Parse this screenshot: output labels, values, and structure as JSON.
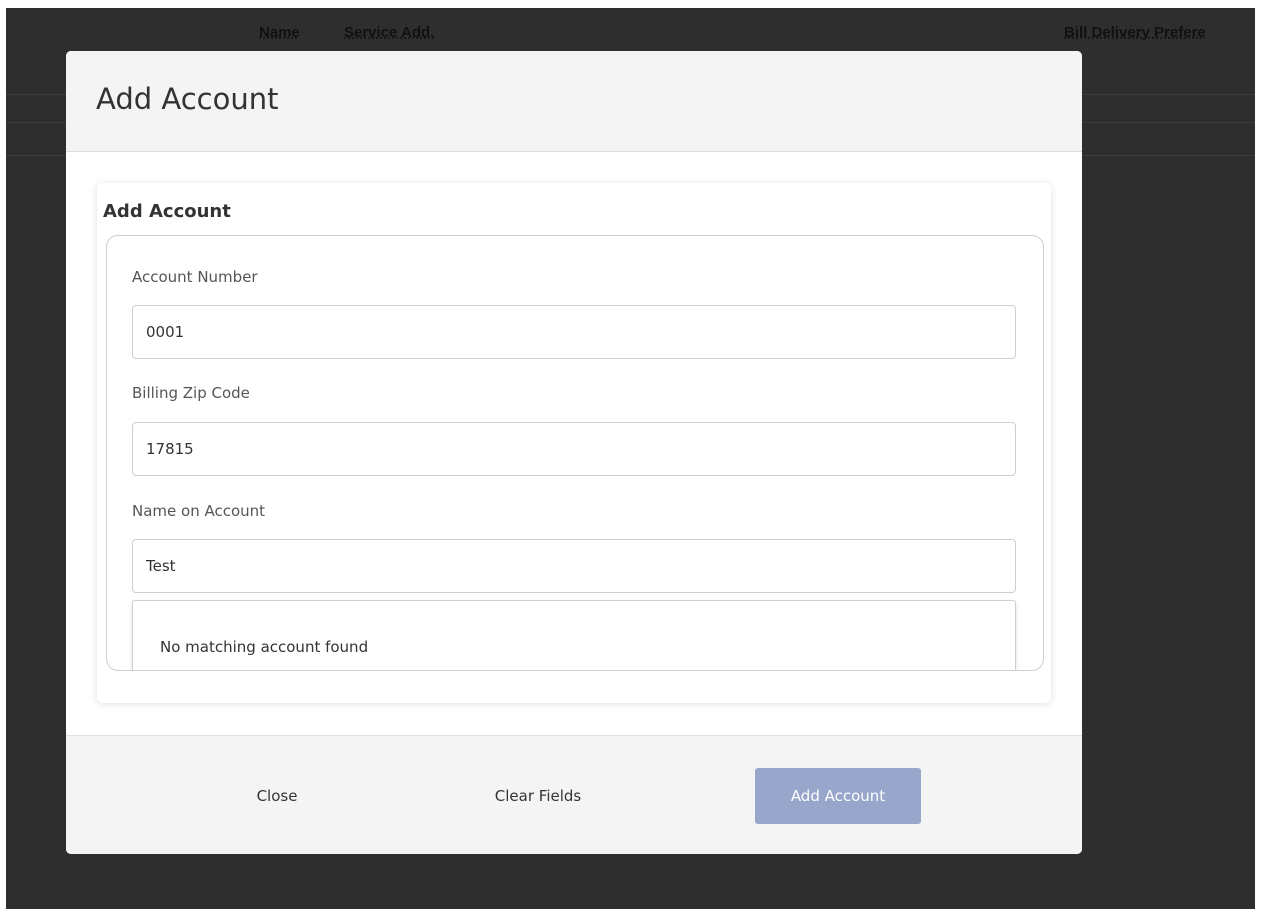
{
  "background_table": {
    "columns": [
      "Name",
      "Service Add.",
      "Bill Delivery Prefere"
    ]
  },
  "modal": {
    "title": "Add Account",
    "card_title": "Add Account",
    "fields": {
      "account_number": {
        "label": "Account Number",
        "value": "0001"
      },
      "billing_zip": {
        "label": "Billing Zip Code",
        "value": "17815"
      },
      "name_on_account": {
        "label": "Name on Account",
        "value": "Test"
      }
    },
    "dropdown": {
      "message": "No matching account found"
    },
    "footer": {
      "close_label": "Close",
      "clear_label": "Clear Fields",
      "add_label": "Add Account"
    }
  },
  "colors": {
    "overlay": "#2e2e2e",
    "primary_button_disabled": "#98a6cc",
    "header_footer_bg": "#f4f4f4"
  }
}
